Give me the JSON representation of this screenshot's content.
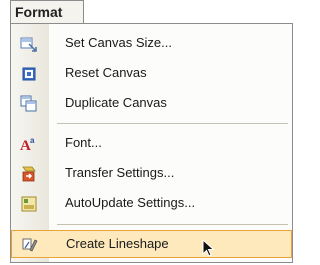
{
  "menu": {
    "title": "Format",
    "items": [
      {
        "label": "Set Canvas Size...",
        "icon": "canvas-size-icon"
      },
      {
        "label": "Reset Canvas",
        "icon": "reset-canvas-icon"
      },
      {
        "label": "Duplicate Canvas",
        "icon": "duplicate-canvas-icon"
      },
      {
        "label": "Font...",
        "icon": "font-icon"
      },
      {
        "label": "Transfer Settings...",
        "icon": "transfer-settings-icon"
      },
      {
        "label": "AutoUpdate Settings...",
        "icon": "autoupdate-settings-icon"
      },
      {
        "label": "Create Lineshape",
        "icon": "create-lineshape-icon"
      }
    ]
  },
  "colors": {
    "highlight_bg": "#fde9bc",
    "highlight_border": "#e9a33b",
    "menu_border": "#8c8c8c"
  }
}
